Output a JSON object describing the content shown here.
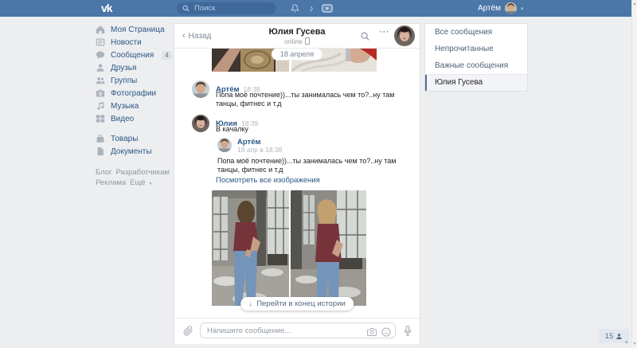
{
  "topbar": {
    "logo": "vk",
    "search_placeholder": "Поиск",
    "user_name": "Артём"
  },
  "glyphs": {
    "scroll_up": "▲",
    "scroll_down": "▼",
    "user_dropdown": "▾",
    "music_note": "♪",
    "back_chevron": "‹",
    "header_ellipsis": "⋯",
    "arrow_down": "↓",
    "more_chevron": "▾",
    "collapse_chevron": "▾"
  },
  "sidebar": {
    "items": [
      {
        "label": "Моя Страница",
        "icon": "home-icon"
      },
      {
        "label": "Новости",
        "icon": "news-icon"
      },
      {
        "label": "Сообщения",
        "icon": "messages-icon",
        "badge": "4"
      },
      {
        "label": "Друзья",
        "icon": "friends-icon"
      },
      {
        "label": "Группы",
        "icon": "groups-icon"
      },
      {
        "label": "Фотографии",
        "icon": "photos-icon"
      },
      {
        "label": "Музыка",
        "icon": "music-icon"
      },
      {
        "label": "Видео",
        "icon": "video-icon"
      },
      {
        "label": "Товары",
        "icon": "market-icon"
      },
      {
        "label": "Документы",
        "icon": "docs-icon"
      }
    ],
    "footer": [
      "Блог",
      "Разработчикам",
      "Реклама",
      "Ещё"
    ]
  },
  "chat": {
    "back_label": "Назад",
    "title": "Юлия Гусева",
    "status": "online",
    "date_separator": "18 апреля",
    "messages": [
      {
        "author": "Артём",
        "time": "18:38",
        "text": "Попа моё почтение))...ты занималась чем то?..ну там танцы, фитнес и т.д"
      },
      {
        "author": "Юлия",
        "time": "18:39",
        "text": "В качалку",
        "quote": {
          "author": "Артём",
          "date": "18 апр в 18:38",
          "text": "Попа моё почтение))...ты занималась чем то?..ну там танцы, фитнес и т.д"
        }
      }
    ],
    "view_all_images_label": "Посмотреть все изображения",
    "jump_button_label": "Перейти в конец истории",
    "input_placeholder": "Напишите сообщение..."
  },
  "messages_menu": {
    "items": [
      "Все сообщения",
      "Непрочитанные",
      "Важные сообщения"
    ],
    "active_item": "Юлия Гусева"
  },
  "widgets": {
    "online_friends_count": "15"
  },
  "colors": {
    "topbar_bg": "#4a76a8",
    "page_bg": "#edeef0",
    "link_blue": "#2a5885",
    "active_item_border": "#526d93",
    "counter_badge_bg": "#e0e2e8",
    "shirt_maroon": "#74343a",
    "jeans_blue": "#7494ba"
  }
}
